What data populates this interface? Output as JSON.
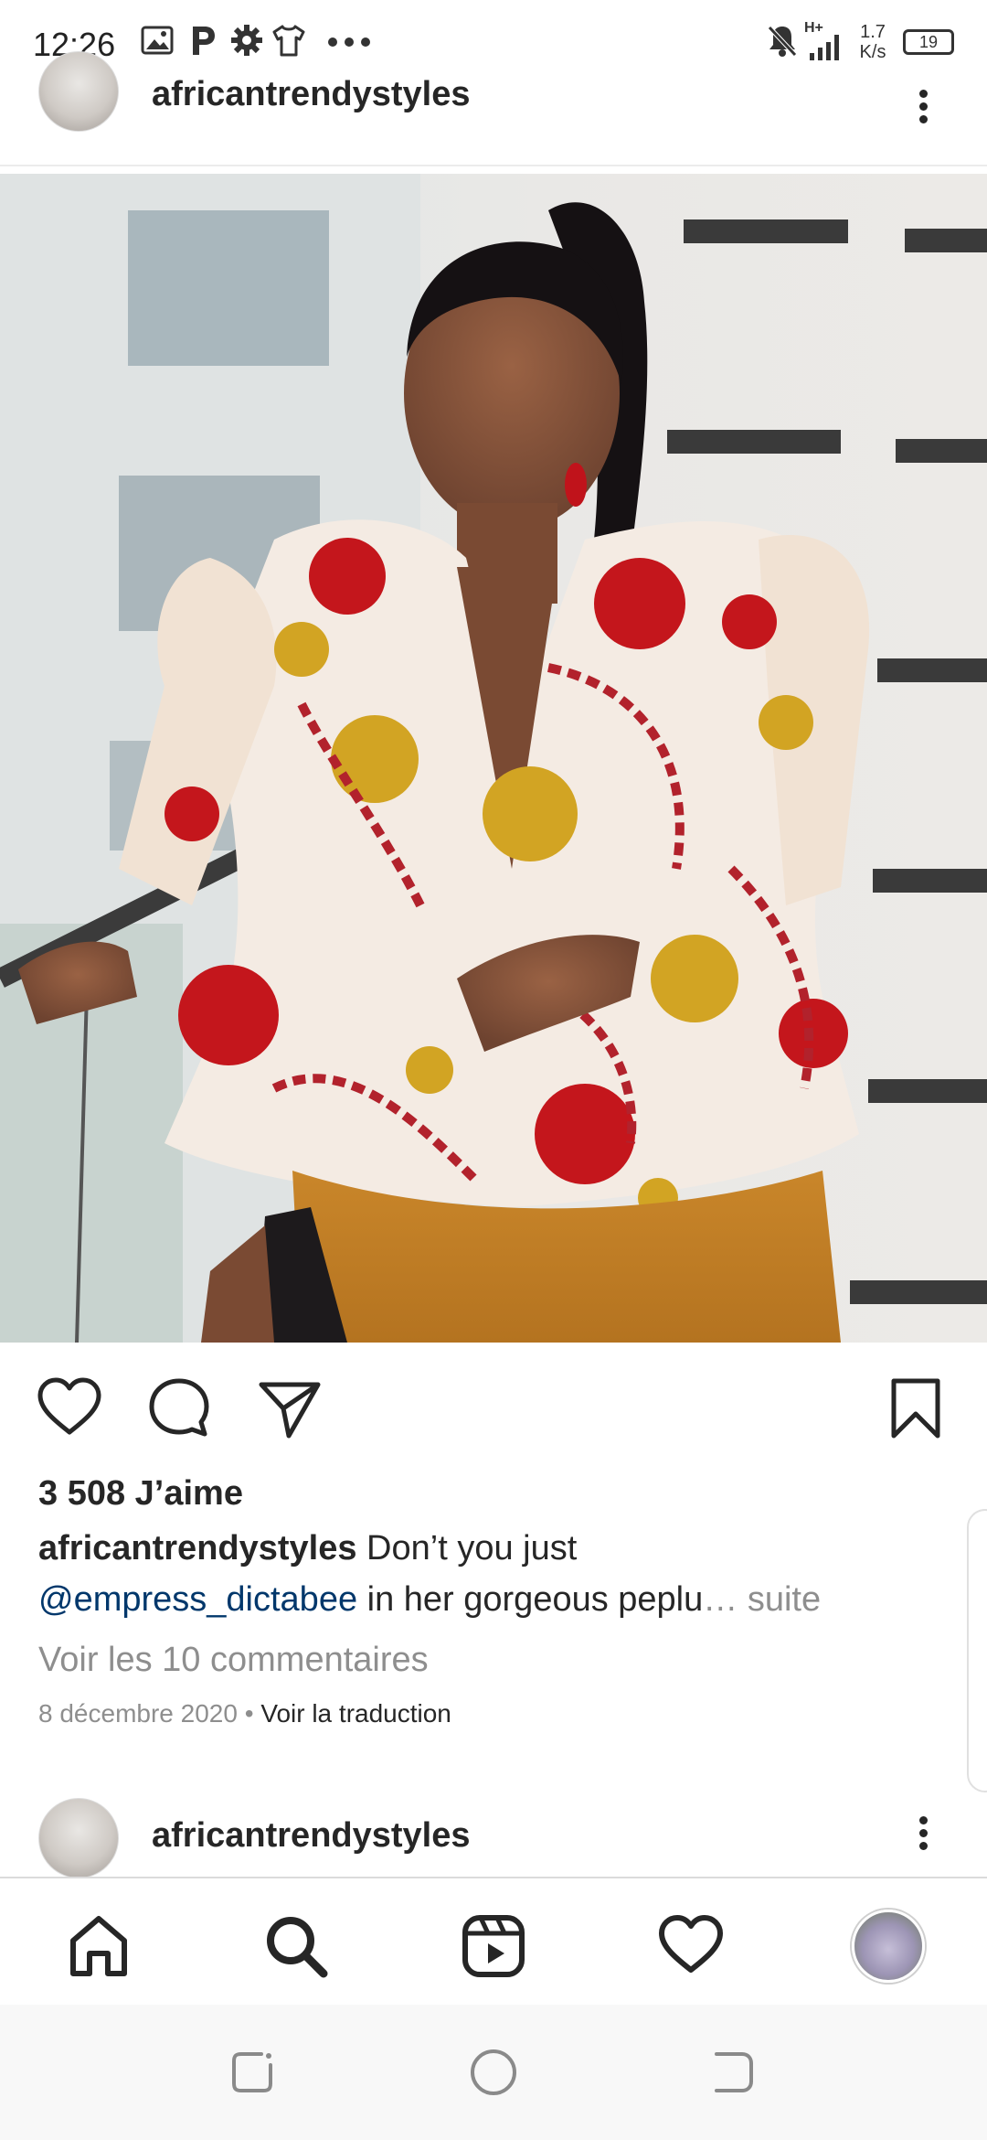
{
  "status_bar": {
    "time": "12:26",
    "network_speed_value": "1.7",
    "network_speed_unit": "K/s",
    "battery": "19",
    "signal_label": "H+"
  },
  "post1": {
    "username": "africantrendystyles"
  },
  "actions": {
    "like": "heart-icon",
    "comment": "comment-icon",
    "share": "send-icon",
    "save": "bookmark-icon"
  },
  "likes": "3 508 J’aime",
  "caption": {
    "username": "africantrendystyles",
    "text_line1": " Don’t you just",
    "mention": "@empress_dictabee",
    "text_line2": " in her gorgeous peplu",
    "ellipsis": "… ",
    "more": "suite"
  },
  "view_comments": "Voir les 10 commentaires",
  "date": "8 décembre 2020",
  "date_separator": " • ",
  "translate": "Voir la traduction",
  "post2": {
    "username": "africantrendystyles"
  },
  "bottom_nav": {
    "home": "home-icon",
    "search": "search-icon",
    "reels": "reels-icon",
    "activity": "heart-icon",
    "profile": "profile-avatar"
  },
  "colors": {
    "text": "#262626",
    "secondary": "#8e8e8e",
    "link": "#00376b"
  }
}
